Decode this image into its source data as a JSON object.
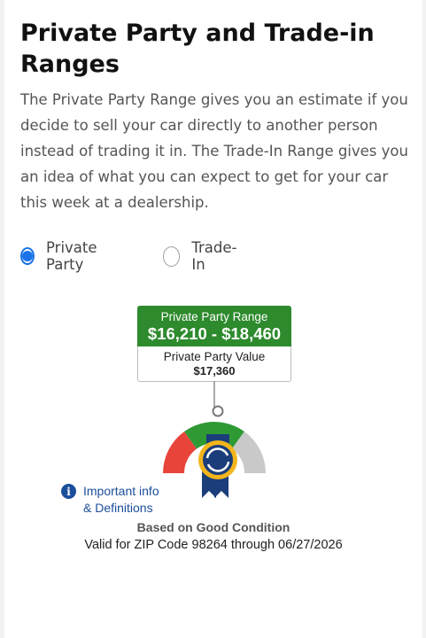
{
  "heading": "Private Party and Trade-in Ranges",
  "description": "The Private Party Range gives you an estimate if you decide to sell your car directly to another person instead of trading it in. The Trade-In Range gives you an idea of what you can expect to get for your car this week at a dealership.",
  "options": [
    {
      "label": "Private Party",
      "selected": true
    },
    {
      "label": "Trade-In",
      "selected": false
    }
  ],
  "range": {
    "label": "Private Party Range",
    "value": "$16,210 - $18,460",
    "value_label": "Private Party Value",
    "value_amount": "$17,360"
  },
  "gauge_colors": {
    "low": "#e8443a",
    "mid": "#2f9a34",
    "high": "#c9c9c9",
    "ribbon": "#1b3d7a",
    "badge_gold": "#f2b51c"
  },
  "info": {
    "line1": "Important info",
    "line2": "& Definitions"
  },
  "condition": "Based on Good Condition",
  "validity": "Valid for ZIP Code 98264 through 06/27/2026"
}
